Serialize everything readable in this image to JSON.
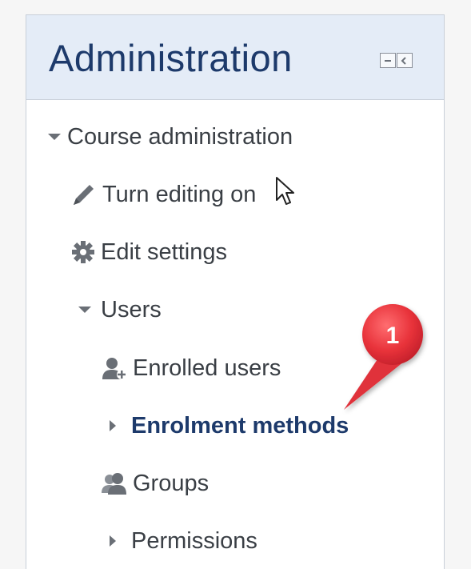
{
  "block": {
    "title": "Administration",
    "controls": [
      {
        "name": "collapse-block-icon"
      },
      {
        "name": "dock-block-icon"
      }
    ]
  },
  "tree": {
    "course_admin": {
      "label": "Course administration",
      "icon": "caret-down-icon"
    },
    "turn_editing": {
      "label": "Turn editing on",
      "icon": "pencil-icon"
    },
    "edit_settings": {
      "label": "Edit settings",
      "icon": "gear-icon"
    },
    "users": {
      "label": "Users",
      "icon": "caret-down-icon"
    },
    "enrolled_users": {
      "label": "Enrolled users",
      "icon": "user-plus-icon"
    },
    "enrolment_methods": {
      "label": "Enrolment methods",
      "icon": "caret-right-icon"
    },
    "groups": {
      "label": "Groups",
      "icon": "users-icon"
    },
    "permissions": {
      "label": "Permissions",
      "icon": "caret-right-icon"
    }
  },
  "callout": {
    "number": "1",
    "color": "#e8323a"
  },
  "colors": {
    "header_bg": "#e4ecf7",
    "title": "#1d3a6b",
    "text": "#3a3f45",
    "active": "#1d3a6b"
  }
}
